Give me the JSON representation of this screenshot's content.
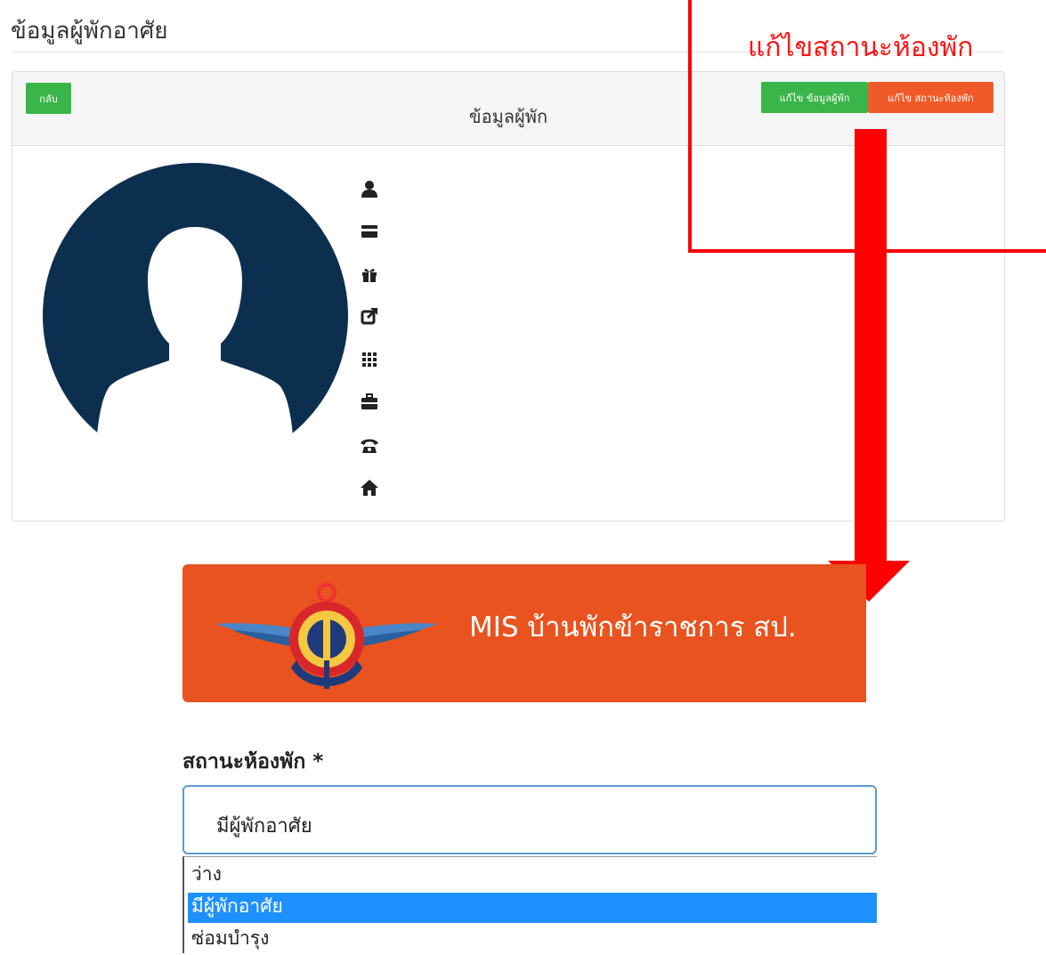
{
  "page": {
    "title": "ข้อมูลผู้พักอาศัย"
  },
  "panel": {
    "title": "ข้อมูลผู้พัก",
    "back_label": "กลับ",
    "edit_info_label": "แก้ไข ข้อมูลผู้พัก",
    "edit_status_label": "แก้ไข สถานะห้องพัก"
  },
  "info_icons": [
    "user-icon",
    "card-icon",
    "gift-icon",
    "share-icon",
    "grid-icon",
    "briefcase-icon",
    "phone-icon",
    "home-icon"
  ],
  "annotation": {
    "label": "แก้ไขสถานะห้องพัก"
  },
  "banner": {
    "title": "MIS บ้านพักข้าราชการ สป."
  },
  "status_form": {
    "label": "สถานะห้องพัก *",
    "selected": "มีผู้พักอาศัย",
    "options": [
      "ว่าง",
      "มีผู้พักอาศัย",
      "ซ่อมบำรุง"
    ]
  },
  "colors": {
    "green_button": "#3ab54a",
    "orange_button": "#f05a28",
    "banner_orange": "#e8531f",
    "avatar_navy": "#0d2f4f",
    "annotation_red": "#ff0000",
    "selected_option": "#1e90ff"
  }
}
